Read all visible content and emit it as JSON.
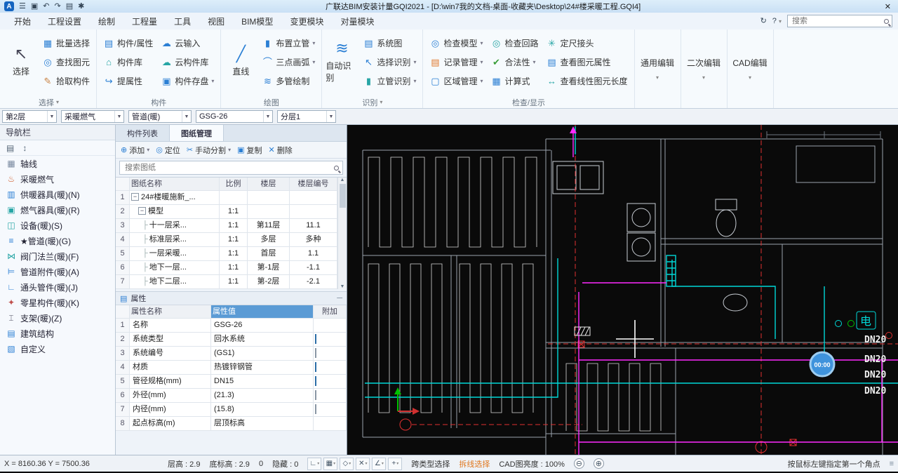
{
  "titlebar": {
    "logo": "A",
    "icons": {
      "menu": "☰",
      "save": "▣",
      "undo": "↶",
      "redo": "↷",
      "layers": "▤",
      "settings": "✱"
    },
    "title": "广联达BIM安装计量GQI2021 - [D:\\win7我的文档-桌面-收藏夹\\Desktop\\24#楼采暖工程.GQI4]",
    "close": "✕"
  },
  "tabbar": {
    "tabs": [
      {
        "label": "开始"
      },
      {
        "label": "工程设置"
      },
      {
        "label": "绘制",
        "active": true
      },
      {
        "label": "工程量"
      },
      {
        "label": "工具"
      },
      {
        "label": "视图"
      },
      {
        "label": "BIM模型"
      },
      {
        "label": "变更模块"
      },
      {
        "label": "对量模块"
      }
    ],
    "sync_icon": "↻",
    "help": "?",
    "search_placeholder": "搜索"
  },
  "ribbon": {
    "select_group": {
      "label": "选择",
      "big": {
        "label": "选择",
        "icon": "↖",
        "color": "#445"
      },
      "items": [
        {
          "label": "批量选择",
          "icon": "▦",
          "color": "#2b7fd4"
        },
        {
          "label": "查找图元",
          "icon": "◎",
          "color": "#2b7fd4"
        },
        {
          "label": "拾取构件",
          "icon": "✎",
          "color": "#c77f3e"
        }
      ]
    },
    "component_group": {
      "label": "构件",
      "cols": [
        [
          {
            "label": "构件/属性",
            "icon": "▤",
            "color": "#2b7fd4"
          },
          {
            "label": "构件库",
            "icon": "⌂",
            "color": "#27a5a5"
          },
          {
            "label": "提属性",
            "icon": "↪",
            "color": "#2b7fd4"
          }
        ],
        [
          {
            "label": "云输入",
            "icon": "☁",
            "color": "#2b7fd4"
          },
          {
            "label": "云构件库",
            "icon": "☁",
            "color": "#27a5a5"
          },
          {
            "label": "构件存盘",
            "icon": "▣",
            "color": "#2b7fd4",
            "arrow": true
          }
        ]
      ]
    },
    "draw_group": {
      "label": "绘图",
      "big": {
        "label": "直线",
        "icon": "╱",
        "color": "#2b7fd4"
      },
      "items": [
        {
          "label": "布置立管",
          "icon": "▮",
          "color": "#2b7fd4",
          "arrow": true
        },
        {
          "label": "三点画弧",
          "icon": "⌒",
          "color": "#2b7fd4",
          "arrow": true
        },
        {
          "label": "多管绘制",
          "icon": "≋",
          "color": "#2b7fd4"
        }
      ]
    },
    "identify_group": {
      "label": "识别",
      "big": {
        "label": "自动识别",
        "icon": "≋",
        "color": "#2b7fd4"
      },
      "items": [
        {
          "label": "系统图",
          "icon": "▤",
          "color": "#2b7fd4"
        },
        {
          "label": "选择识别",
          "icon": "↖",
          "color": "#2b7fd4",
          "arrow": true
        },
        {
          "label": "立管识别",
          "icon": "▮",
          "color": "#27a5a5",
          "arrow": true
        }
      ]
    },
    "check_group": {
      "label": "检查/显示",
      "cols": [
        [
          {
            "label": "检查模型",
            "icon": "◎",
            "color": "#2b7fd4",
            "arrow": true
          },
          {
            "label": "记录管理",
            "icon": "▤",
            "color": "#e07a2e",
            "arrow": true
          },
          {
            "label": "区域管理",
            "icon": "▢",
            "color": "#2b7fd4",
            "arrow": true
          }
        ],
        [
          {
            "label": "检查回路",
            "icon": "◎",
            "color": "#27a5a5"
          },
          {
            "label": "合法性",
            "icon": "✔",
            "color": "#3a9d3a",
            "arrow": true
          },
          {
            "label": "计算式",
            "icon": "▦",
            "color": "#2b7fd4"
          }
        ],
        [
          {
            "label": "定尺接头",
            "icon": "✳",
            "color": "#27a5a5"
          },
          {
            "label": "查看图元属性",
            "icon": "▤",
            "color": "#2b7fd4"
          },
          {
            "label": "查看线性图元长度",
            "icon": "↔",
            "color": "#27a5a5"
          }
        ]
      ]
    },
    "tall_buttons": [
      {
        "label": "通用编辑"
      },
      {
        "label": "二次编辑"
      },
      {
        "label": "CAD编辑"
      }
    ]
  },
  "combobar": {
    "combos": [
      {
        "value": "第2层"
      },
      {
        "value": "采暖燃气"
      },
      {
        "value": "管道(暖)"
      },
      {
        "value": "GSG-26"
      },
      {
        "value": "分层1"
      }
    ]
  },
  "nav": {
    "header": "导航栏",
    "tools": [
      "▤",
      "↕"
    ],
    "items": [
      {
        "label": "轴线",
        "icon": "▦",
        "color": "#7a8aa0"
      },
      {
        "label": "采暖燃气",
        "icon": "♨",
        "color": "#d06030",
        "section": true
      },
      {
        "label": "供暖器具(暖)(N)",
        "icon": "▥",
        "color": "#2b7fd4",
        "sub": true
      },
      {
        "label": "燃气器具(暖)(R)",
        "icon": "▣",
        "color": "#27a5a5",
        "sub": true
      },
      {
        "label": "设备(暖)(S)",
        "icon": "◫",
        "color": "#27a5a5",
        "sub": true
      },
      {
        "label": "★管道(暖)(G)",
        "icon": "≡",
        "color": "#2b7fd4",
        "sub": true,
        "selected": true
      },
      {
        "label": "阀门法兰(暖)(F)",
        "icon": "⋈",
        "color": "#27a5a5",
        "sub": true
      },
      {
        "label": "管道附件(暖)(A)",
        "icon": "⊨",
        "color": "#2b7fd4",
        "sub": true
      },
      {
        "label": "通头管件(暖)(J)",
        "icon": "∟",
        "color": "#2b7fd4",
        "sub": true
      },
      {
        "label": "零星构件(暖)(K)",
        "icon": "✦",
        "color": "#c0504d",
        "sub": true
      },
      {
        "label": "支架(暖)(Z)",
        "icon": "⌶",
        "color": "#556",
        "sub": true
      },
      {
        "label": "建筑结构",
        "icon": "▤",
        "color": "#2b7fd4",
        "section": true
      },
      {
        "label": "自定义",
        "icon": "▧",
        "color": "#2b7fd4",
        "section": true
      }
    ]
  },
  "panel": {
    "tabs": [
      {
        "label": "构件列表"
      },
      {
        "label": "图纸管理",
        "active": true
      }
    ],
    "toolbar": [
      {
        "label": "添加",
        "icon": "⊕",
        "arrow": true
      },
      {
        "label": "定位",
        "icon": "◎",
        "disabled": true
      },
      {
        "label": "手动分割",
        "icon": "✂",
        "arrow": true,
        "disabled": true
      },
      {
        "label": "复制",
        "icon": "▣",
        "disabled": true
      },
      {
        "label": "删除",
        "icon": "✕",
        "disabled": true
      }
    ],
    "search_placeholder": "搜索图纸",
    "sheet_table": {
      "headers": [
        "图纸名称",
        "比例",
        "楼层",
        "楼层编号"
      ],
      "rows": [
        {
          "num": "1",
          "name": "24#楼暖施新_...",
          "scale": "",
          "floor": "",
          "floor_no": "",
          "expander": true
        },
        {
          "num": "2",
          "name": "模型",
          "scale": "1:1",
          "floor": "",
          "floor_no": "",
          "expander": true,
          "ind1": true
        },
        {
          "num": "3",
          "name": "十一层采...",
          "scale": "1:1",
          "floor": "第11层",
          "floor_no": "11.1",
          "tree": true,
          "ind2": true
        },
        {
          "num": "4",
          "name": "标准层采...",
          "scale": "1:1",
          "floor": "多层",
          "floor_no": "多种",
          "tree": true,
          "ind2": true,
          "selected": true
        },
        {
          "num": "5",
          "name": "一层采暖...",
          "scale": "1:1",
          "floor": "首层",
          "floor_no": "1.1",
          "tree": true,
          "ind2": true
        },
        {
          "num": "6",
          "name": "地下一层...",
          "scale": "1:1",
          "floor": "第-1层",
          "floor_no": "-1.1",
          "tree": true,
          "ind2": true
        },
        {
          "num": "7",
          "name": "地下二层...",
          "scale": "1:1",
          "floor": "第-2层",
          "floor_no": "-2.1",
          "tree": true,
          "ind2": true
        }
      ]
    },
    "properties": {
      "header": "属性",
      "header_icon": "▤",
      "table_headers": [
        "属性名称",
        "属性值",
        "附加"
      ],
      "rows": [
        {
          "num": "1",
          "name": "名称",
          "value": "GSG-26",
          "hide_check": true
        },
        {
          "num": "2",
          "name": "系统类型",
          "value": "回水系统",
          "checked": true
        },
        {
          "num": "3",
          "name": "系统编号",
          "value": "(GS1)"
        },
        {
          "num": "4",
          "name": "材质",
          "value": "热镀锌钢管",
          "checked": true
        },
        {
          "num": "5",
          "name": "管径规格(mm)",
          "value": "DN15",
          "checked": true
        },
        {
          "num": "6",
          "name": "外径(mm)",
          "value": "(21.3)",
          "selected": true
        },
        {
          "num": "7",
          "name": "内径(mm)",
          "value": "(15.8)"
        },
        {
          "num": "8",
          "name": "起点标高(m)",
          "value": "层顶标高",
          "hide_check": true
        }
      ]
    }
  },
  "canvas": {
    "pipe_labels": [
      "DN20",
      "DN20",
      "DN20",
      "DN20"
    ],
    "electric_label": "电",
    "timer": "00:00",
    "tools": [
      "◎",
      "⊕",
      "□",
      "▣",
      "◇",
      "↻",
      "▤",
      "≡"
    ],
    "colors": {
      "pipe_cyan": "#00d8d8",
      "pipe_magenta": "#ff2bff",
      "axis_red": "#e03030",
      "coil_white": "#d8d8d8"
    }
  },
  "statusbar": {
    "coords": "X = 8160.36 Y = 7500.36",
    "floor_height": "层高 : 2.9",
    "bottom_elevation": "底标高 : 2.9",
    "count": "0",
    "hidden": "隐藏 : 0",
    "tools": [
      "∟",
      "▦",
      "◇",
      "✕",
      "∠",
      "+"
    ],
    "cross_type_select": "跨类型选择",
    "polyline_select": "拆线选择",
    "brightness": "CAD图亮度 : 100%",
    "minus": "⊖",
    "plus": "⊕",
    "hint": "按鼠标左键指定第一个角点",
    "grip": "≡"
  }
}
